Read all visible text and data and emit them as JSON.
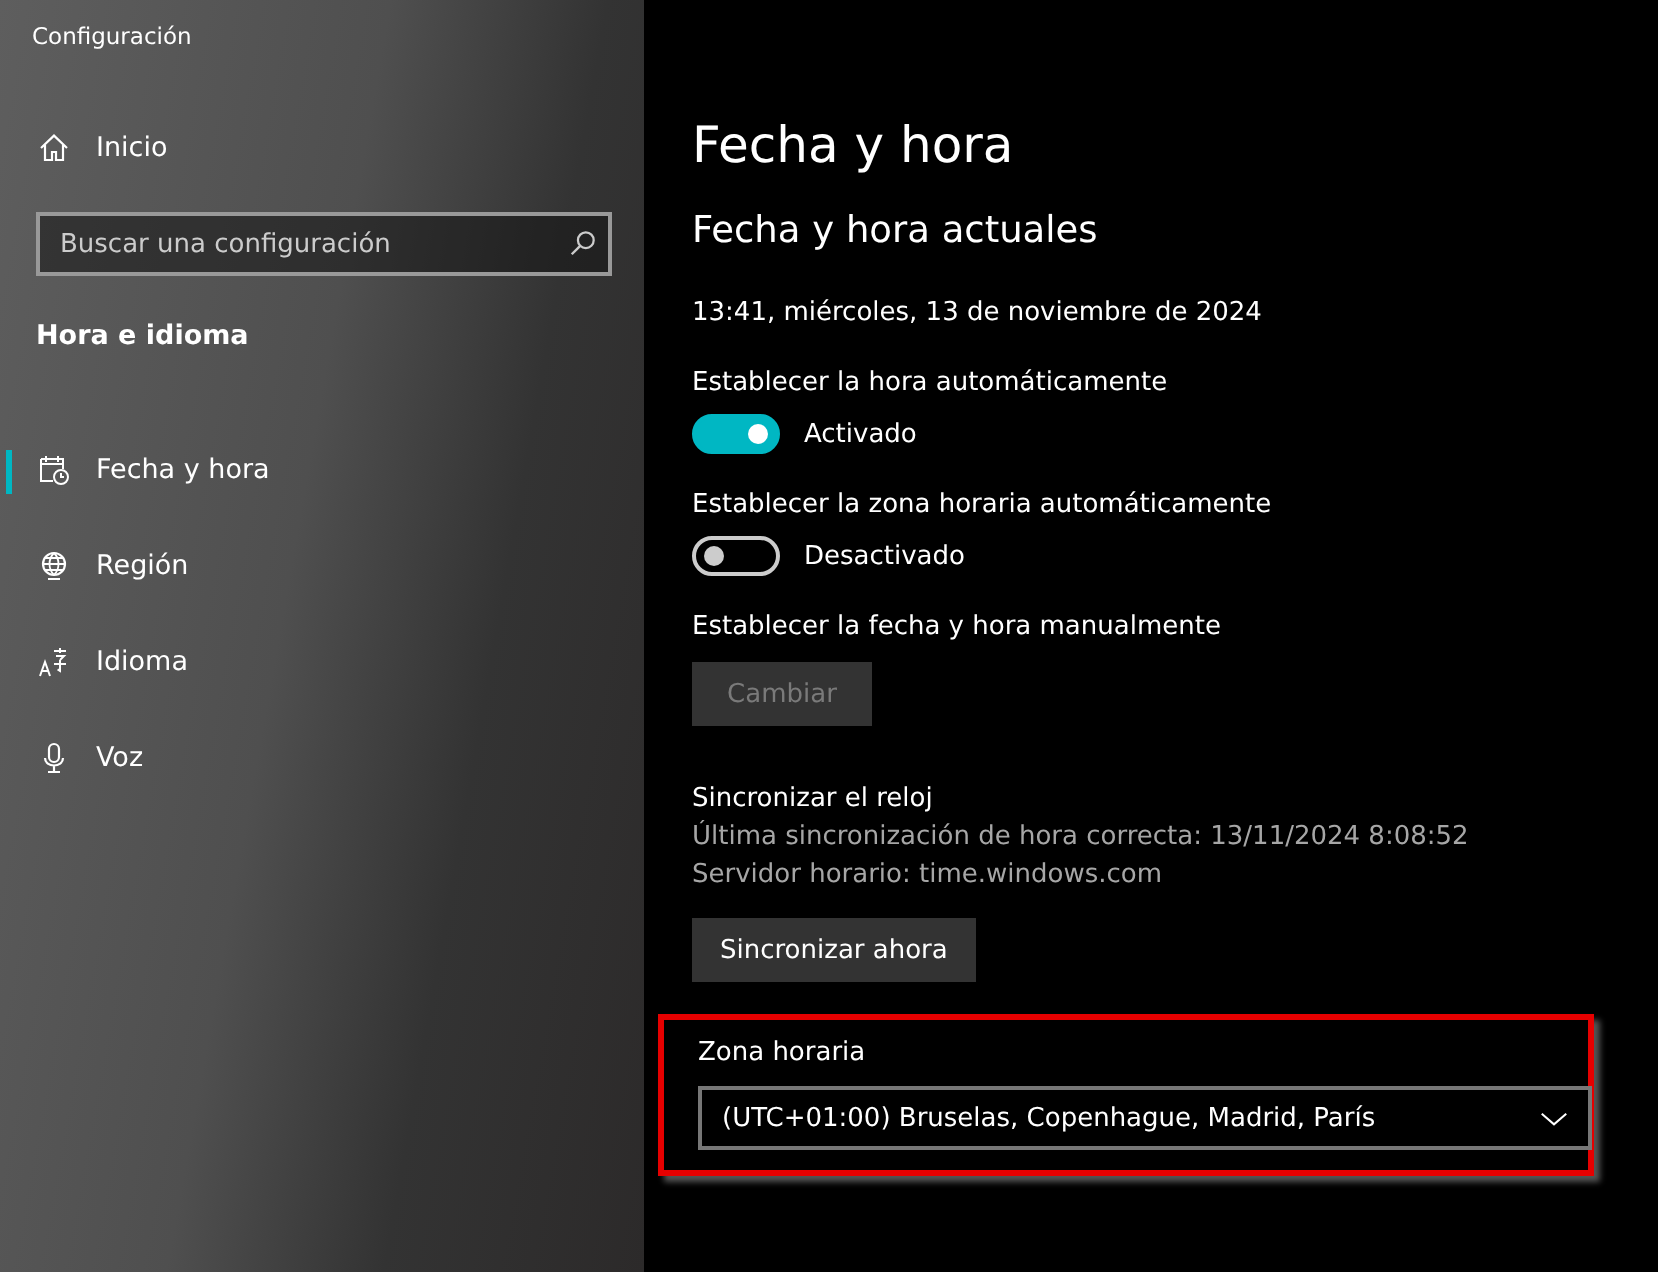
{
  "window": {
    "title": "Configuración"
  },
  "sidebar": {
    "home": "Inicio",
    "search": {
      "placeholder": "Buscar una configuración"
    },
    "section": "Hora e idioma",
    "items": [
      {
        "label": "Fecha y hora",
        "kind": "calendar",
        "selected": true
      },
      {
        "label": "Región",
        "kind": "globe",
        "selected": false
      },
      {
        "label": "Idioma",
        "kind": "language",
        "selected": false
      },
      {
        "label": "Voz",
        "kind": "microphone",
        "selected": false
      }
    ]
  },
  "page": {
    "title": "Fecha y hora",
    "subtitle": "Fecha y hora actuales",
    "current": "13:41, miércoles, 13 de noviembre de 2024",
    "settings": [
      {
        "kind": "toggle",
        "label": "Establecer la hora automáticamente",
        "on": true,
        "state": "Activado"
      },
      {
        "kind": "toggle",
        "label": "Establecer la zona horaria automáticamente",
        "on": false,
        "state": "Desactivado"
      },
      {
        "kind": "button",
        "label": "Establecer la fecha y hora manualmente",
        "button": "Cambiar",
        "disabled": true
      }
    ],
    "sync": {
      "title": "Sincronizar el reloj",
      "lines": [
        "Última sincronización de hora correcta: 13/11/2024 8:08:52",
        "Servidor horario: time.windows.com"
      ],
      "button": "Sincronizar ahora"
    },
    "timezone": {
      "label": "Zona horaria",
      "value": "(UTC+01:00) Bruselas, Copenhague, Madrid, París",
      "highlighted": true
    }
  }
}
